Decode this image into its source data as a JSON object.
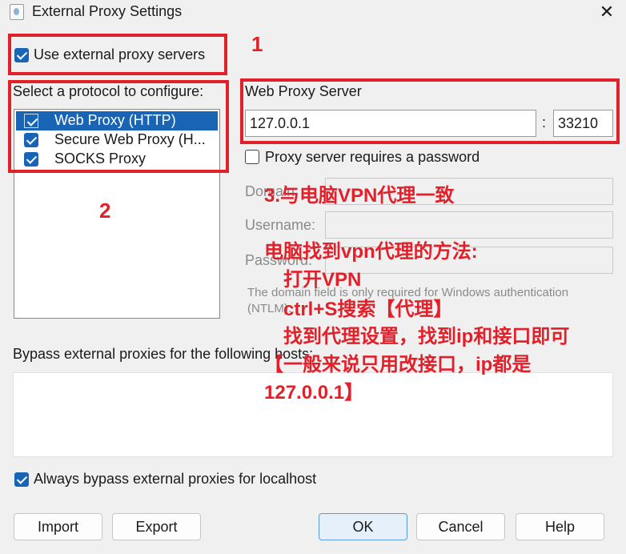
{
  "window": {
    "title": "External Proxy Settings"
  },
  "use_external": {
    "label": "Use external proxy servers",
    "checked": true
  },
  "protocol": {
    "heading": "Select a protocol to configure:",
    "items": [
      {
        "label": "Web Proxy (HTTP)",
        "checked": true,
        "selected": true
      },
      {
        "label": "Secure Web Proxy (H...",
        "checked": true,
        "selected": false
      },
      {
        "label": "SOCKS Proxy",
        "checked": true,
        "selected": false
      }
    ]
  },
  "server": {
    "heading": "Web Proxy Server",
    "host": "127.0.0.1",
    "separator": ":",
    "port": "33210"
  },
  "auth": {
    "requires_password_label": "Proxy server requires a password",
    "requires_password_checked": false,
    "domain_label": "Domain:",
    "username_label": "Username:",
    "password_label": "Password:",
    "help": "The domain field is only required for Windows authentication (NTLM)."
  },
  "bypass": {
    "label": "Bypass external proxies for the following hosts:",
    "always_localhost_label": "Always bypass external proxies for localhost",
    "always_localhost_checked": true
  },
  "buttons": {
    "import": "Import",
    "export": "Export",
    "ok": "OK",
    "cancel": "Cancel",
    "help": "Help"
  },
  "annotations": {
    "n1": "1",
    "n2": "2",
    "n3": "3.与电脑VPN代理一致",
    "line1": "电脑找到vpn代理的方法:",
    "line2": "打开VPN",
    "line3": "ctrl+S搜索【代理】",
    "line4": "找到代理设置，找到ip和接口即可",
    "line5": "【一般来说只用改接口，ip都是",
    "line6": "127.0.0.1】"
  },
  "colors": {
    "annotation": "#e2202a",
    "accent": "#1964b4"
  }
}
